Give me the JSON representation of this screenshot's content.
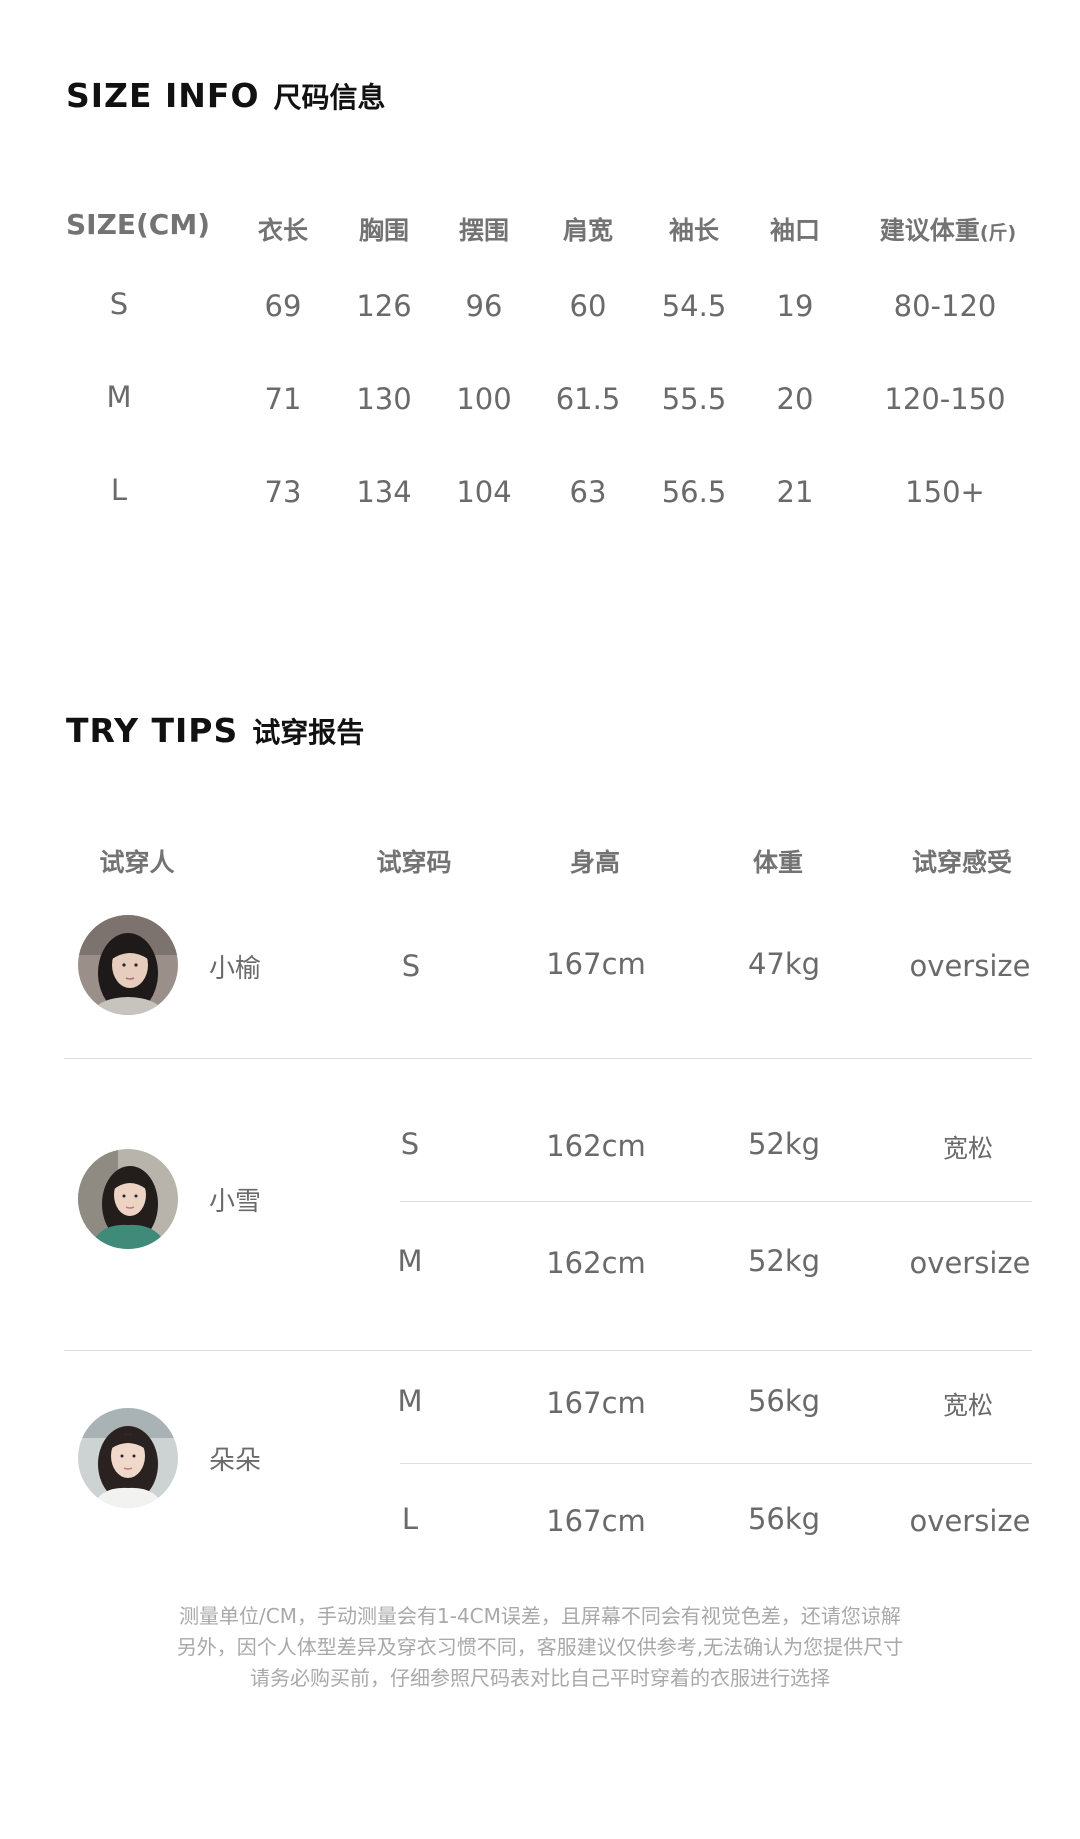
{
  "size_info": {
    "title_en": "SIZE INFO",
    "title_cn": "尺码信息",
    "header_size": "SIZE(CM)",
    "columns": [
      "衣长",
      "胸围",
      "摆围",
      "肩宽",
      "袖长",
      "袖口"
    ],
    "weight_header": "建议体重",
    "weight_unit": "(斤)",
    "rows": [
      {
        "size": "S",
        "values": [
          "69",
          "126",
          "96",
          "60",
          "54.5",
          "19"
        ],
        "weight": "80-120"
      },
      {
        "size": "M",
        "values": [
          "71",
          "130",
          "100",
          "61.5",
          "55.5",
          "20"
        ],
        "weight": "120-150"
      },
      {
        "size": "L",
        "values": [
          "73",
          "134",
          "104",
          "63",
          "56.5",
          "21"
        ],
        "weight": "150+"
      }
    ]
  },
  "try_tips": {
    "title_en": "TRY TIPS",
    "title_cn": "试穿报告",
    "headers": [
      "试穿人",
      "试穿码",
      "身高",
      "体重",
      "试穿感受"
    ],
    "testers": [
      {
        "name": "小榆",
        "avatar": "tester-photo",
        "rows": [
          {
            "size": "S",
            "height": "167cm",
            "weight": "47kg",
            "feel": "oversize"
          }
        ]
      },
      {
        "name": "小雪",
        "avatar": "tester-photo",
        "rows": [
          {
            "size": "S",
            "height": "162cm",
            "weight": "52kg",
            "feel": "宽松"
          },
          {
            "size": "M",
            "height": "162cm",
            "weight": "52kg",
            "feel": "oversize"
          }
        ]
      },
      {
        "name": "朵朵",
        "avatar": "tester-photo",
        "rows": [
          {
            "size": "M",
            "height": "167cm",
            "weight": "56kg",
            "feel": "宽松"
          },
          {
            "size": "L",
            "height": "167cm",
            "weight": "56kg",
            "feel": "oversize"
          }
        ]
      }
    ]
  },
  "footer": {
    "lines": [
      "测量单位/CM，手动测量会有1-4CM误差，且屏幕不同会有视觉色差，还请您谅解",
      "另外，因个人体型差异及穿衣习惯不同，客服建议仅供参考,无法确认为您提供尺寸",
      "请务必购买前，仔细参照尺码表对比自己平时穿着的衣服进行选择"
    ]
  },
  "colors": {
    "title": "#111111",
    "text": "#6a6a6a",
    "header": "#737373",
    "divider": "#dedede",
    "footer": "#a9a9a9"
  }
}
